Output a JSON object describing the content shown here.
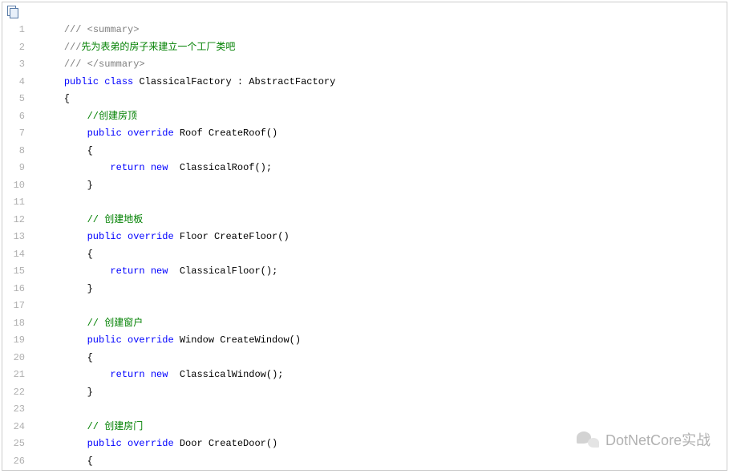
{
  "toolbar": {
    "copy_icon": "copy"
  },
  "lines": [
    {
      "n": "1",
      "tokens": [
        {
          "cls": "",
          "t": "    "
        },
        {
          "cls": "comment-gray",
          "t": "/// <summary>"
        }
      ]
    },
    {
      "n": "2",
      "tokens": [
        {
          "cls": "",
          "t": "    "
        },
        {
          "cls": "comment-gray",
          "t": "///"
        },
        {
          "cls": "comment-green",
          "t": "先为表弟的房子来建立一个工厂类吧"
        }
      ]
    },
    {
      "n": "3",
      "tokens": [
        {
          "cls": "",
          "t": "    "
        },
        {
          "cls": "comment-gray",
          "t": "/// </summary>"
        }
      ]
    },
    {
      "n": "4",
      "tokens": [
        {
          "cls": "",
          "t": "    "
        },
        {
          "cls": "kw",
          "t": "public"
        },
        {
          "cls": "",
          "t": " "
        },
        {
          "cls": "kw",
          "t": "class"
        },
        {
          "cls": "",
          "t": " ClassicalFactory : AbstractFactory"
        }
      ]
    },
    {
      "n": "5",
      "tokens": [
        {
          "cls": "",
          "t": "    {"
        }
      ]
    },
    {
      "n": "6",
      "tokens": [
        {
          "cls": "",
          "t": "        "
        },
        {
          "cls": "comment-green",
          "t": "//创建房顶"
        }
      ]
    },
    {
      "n": "7",
      "tokens": [
        {
          "cls": "",
          "t": "        "
        },
        {
          "cls": "kw",
          "t": "public"
        },
        {
          "cls": "",
          "t": " "
        },
        {
          "cls": "kw",
          "t": "override"
        },
        {
          "cls": "",
          "t": " Roof CreateRoof()"
        }
      ]
    },
    {
      "n": "8",
      "tokens": [
        {
          "cls": "",
          "t": "        {"
        }
      ]
    },
    {
      "n": "9",
      "tokens": [
        {
          "cls": "",
          "t": "            "
        },
        {
          "cls": "kw",
          "t": "return"
        },
        {
          "cls": "",
          "t": " "
        },
        {
          "cls": "kw",
          "t": "new"
        },
        {
          "cls": "",
          "t": "  ClassicalRoof();"
        }
      ]
    },
    {
      "n": "10",
      "tokens": [
        {
          "cls": "",
          "t": "        }"
        }
      ]
    },
    {
      "n": "11",
      "tokens": [
        {
          "cls": "",
          "t": " "
        }
      ]
    },
    {
      "n": "12",
      "tokens": [
        {
          "cls": "",
          "t": "        "
        },
        {
          "cls": "comment-green",
          "t": "// 创建地板"
        }
      ]
    },
    {
      "n": "13",
      "tokens": [
        {
          "cls": "",
          "t": "        "
        },
        {
          "cls": "kw",
          "t": "public"
        },
        {
          "cls": "",
          "t": " "
        },
        {
          "cls": "kw",
          "t": "override"
        },
        {
          "cls": "",
          "t": " Floor CreateFloor()"
        }
      ]
    },
    {
      "n": "14",
      "tokens": [
        {
          "cls": "",
          "t": "        {"
        }
      ]
    },
    {
      "n": "15",
      "tokens": [
        {
          "cls": "",
          "t": "            "
        },
        {
          "cls": "kw",
          "t": "return"
        },
        {
          "cls": "",
          "t": " "
        },
        {
          "cls": "kw",
          "t": "new"
        },
        {
          "cls": "",
          "t": "  ClassicalFloor();"
        }
      ]
    },
    {
      "n": "16",
      "tokens": [
        {
          "cls": "",
          "t": "        }"
        }
      ]
    },
    {
      "n": "17",
      "tokens": [
        {
          "cls": "",
          "t": " "
        }
      ]
    },
    {
      "n": "18",
      "tokens": [
        {
          "cls": "",
          "t": "        "
        },
        {
          "cls": "comment-green",
          "t": "// 创建窗户"
        }
      ]
    },
    {
      "n": "19",
      "tokens": [
        {
          "cls": "",
          "t": "        "
        },
        {
          "cls": "kw",
          "t": "public"
        },
        {
          "cls": "",
          "t": " "
        },
        {
          "cls": "kw",
          "t": "override"
        },
        {
          "cls": "",
          "t": " Window CreateWindow()"
        }
      ]
    },
    {
      "n": "20",
      "tokens": [
        {
          "cls": "",
          "t": "        {"
        }
      ]
    },
    {
      "n": "21",
      "tokens": [
        {
          "cls": "",
          "t": "            "
        },
        {
          "cls": "kw",
          "t": "return"
        },
        {
          "cls": "",
          "t": " "
        },
        {
          "cls": "kw",
          "t": "new"
        },
        {
          "cls": "",
          "t": "  ClassicalWindow();"
        }
      ]
    },
    {
      "n": "22",
      "tokens": [
        {
          "cls": "",
          "t": "        }"
        }
      ]
    },
    {
      "n": "23",
      "tokens": [
        {
          "cls": "",
          "t": " "
        }
      ]
    },
    {
      "n": "24",
      "tokens": [
        {
          "cls": "",
          "t": "        "
        },
        {
          "cls": "comment-green",
          "t": "// 创建房门"
        }
      ]
    },
    {
      "n": "25",
      "tokens": [
        {
          "cls": "",
          "t": "        "
        },
        {
          "cls": "kw",
          "t": "public"
        },
        {
          "cls": "",
          "t": " "
        },
        {
          "cls": "kw",
          "t": "override"
        },
        {
          "cls": "",
          "t": " Door CreateDoor()"
        }
      ]
    },
    {
      "n": "26",
      "tokens": [
        {
          "cls": "",
          "t": "        {"
        }
      ]
    }
  ],
  "watermark": {
    "text": "DotNetCore实战"
  }
}
